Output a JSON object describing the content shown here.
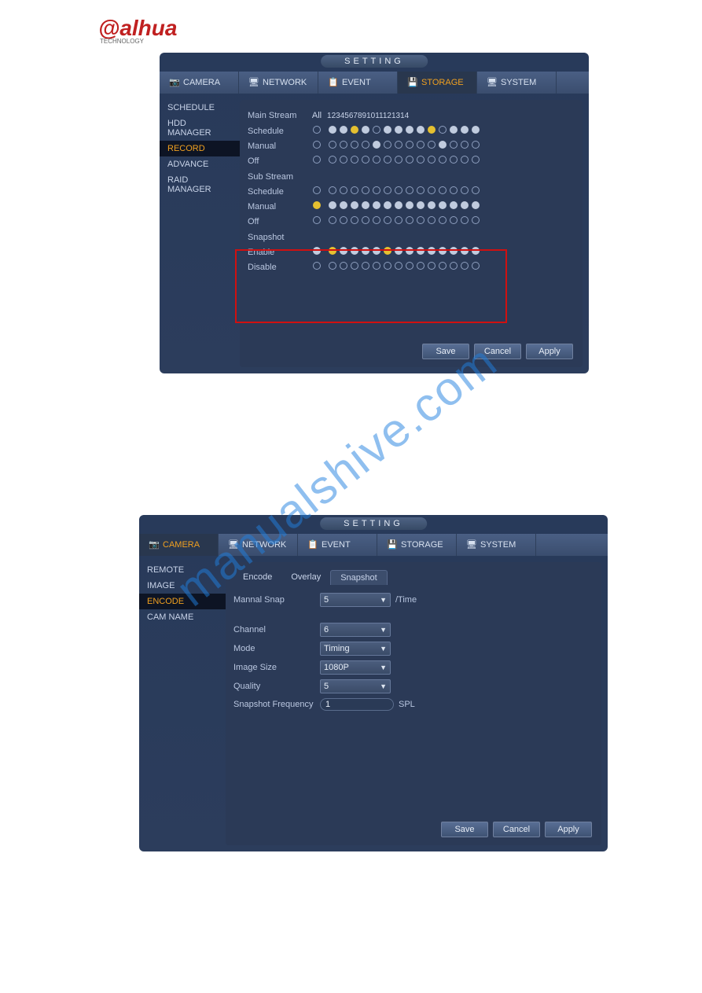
{
  "logo_text": "alhua",
  "logo_sub": "TECHNOLOGY",
  "window_title": "SETTING",
  "top_tabs": {
    "camera": "CAMERA",
    "network": "NETWORK",
    "event": "EVENT",
    "storage": "STORAGE",
    "system": "SYSTEM"
  },
  "storage_panel": {
    "sidebar": [
      "SCHEDULE",
      "HDD MANAGER",
      "RECORD",
      "ADVANCE",
      "RAID MANAGER"
    ],
    "active_side": "RECORD",
    "header_main": "Main Stream",
    "header_all": "All",
    "channels": [
      "1",
      "2",
      "3",
      "4",
      "5",
      "6",
      "7",
      "8",
      "9",
      "10",
      "11",
      "12",
      "13",
      "14"
    ],
    "rows_main": [
      {
        "label": "Schedule",
        "all": "o",
        "cells": [
          "f",
          "f",
          "y",
          "f",
          "o",
          "f",
          "f",
          "f",
          "f",
          "y",
          "o",
          "f",
          "f",
          "f"
        ]
      },
      {
        "label": "Manual",
        "all": "o",
        "cells": [
          "o",
          "o",
          "o",
          "o",
          "f",
          "o",
          "o",
          "o",
          "o",
          "o",
          "f",
          "o",
          "o",
          "o"
        ]
      },
      {
        "label": "Off",
        "all": "o",
        "cells": [
          "o",
          "o",
          "o",
          "o",
          "o",
          "o",
          "o",
          "o",
          "o",
          "o",
          "o",
          "o",
          "o",
          "o"
        ]
      }
    ],
    "header_sub": "Sub Stream",
    "rows_sub": [
      {
        "label": "Schedule",
        "all": "o",
        "cells": [
          "o",
          "o",
          "o",
          "o",
          "o",
          "o",
          "o",
          "o",
          "o",
          "o",
          "o",
          "o",
          "o",
          "o"
        ]
      },
      {
        "label": "Manual",
        "all": "y",
        "cells": [
          "f",
          "f",
          "f",
          "f",
          "f",
          "f",
          "f",
          "f",
          "f",
          "f",
          "f",
          "f",
          "f",
          "f"
        ]
      },
      {
        "label": "Off",
        "all": "o",
        "cells": [
          "o",
          "o",
          "o",
          "o",
          "o",
          "o",
          "o",
          "o",
          "o",
          "o",
          "o",
          "o",
          "o",
          "o"
        ]
      }
    ],
    "header_snap": "Snapshot",
    "rows_snap": [
      {
        "label": "Enable",
        "all": "f",
        "cells": [
          "y",
          "f",
          "f",
          "f",
          "f",
          "y",
          "f",
          "f",
          "f",
          "f",
          "f",
          "f",
          "f",
          "f"
        ]
      },
      {
        "label": "Disable",
        "all": "o",
        "cells": [
          "o",
          "o",
          "o",
          "o",
          "o",
          "o",
          "o",
          "o",
          "o",
          "o",
          "o",
          "o",
          "o",
          "o"
        ]
      }
    ],
    "buttons": {
      "save": "Save",
      "cancel": "Cancel",
      "apply": "Apply"
    }
  },
  "camera_panel": {
    "sidebar": [
      "REMOTE",
      "IMAGE",
      "ENCODE",
      "CAM NAME"
    ],
    "active_side": "ENCODE",
    "subtabs": [
      "Encode",
      "Overlay",
      "Snapshot"
    ],
    "active_subtab": "Snapshot",
    "fields": {
      "manual_snap_label": "Mannal Snap",
      "manual_snap_value": "5",
      "manual_snap_unit": "/Time",
      "channel_label": "Channel",
      "channel_value": "6",
      "mode_label": "Mode",
      "mode_value": "Timing",
      "image_size_label": "Image Size",
      "image_size_value": "1080P",
      "quality_label": "Quality",
      "quality_value": "5",
      "snap_freq_label": "Snapshot Frequency",
      "snap_freq_value": "1",
      "snap_freq_unit": "SPL"
    },
    "buttons": {
      "save": "Save",
      "cancel": "Cancel",
      "apply": "Apply"
    }
  },
  "watermark": "manualshive.com"
}
